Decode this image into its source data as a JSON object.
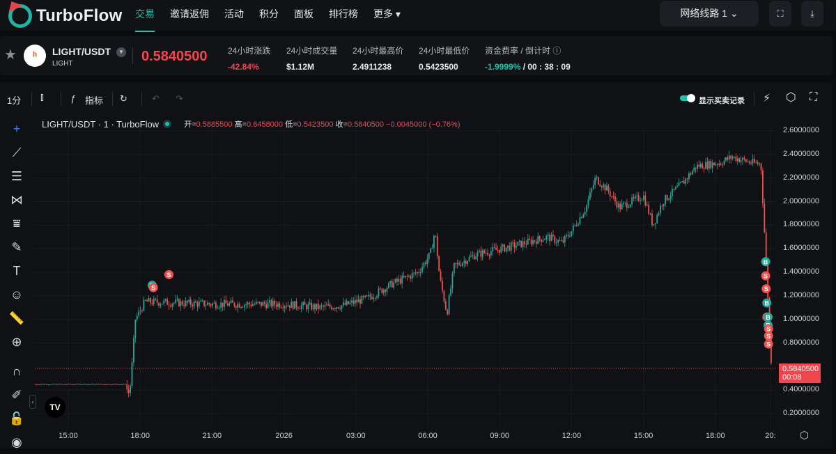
{
  "nav": {
    "brand": "TurboFlow",
    "items": [
      "交易",
      "邀请返佣",
      "活动",
      "积分",
      "面板",
      "排行榜",
      "更多 ▾"
    ],
    "network": "网络线路 1 ⌄"
  },
  "ticker": {
    "pair": "LIGHT/USDT",
    "base": "LIGHT",
    "coin_glyph": "LT",
    "last_price": "0.5840500",
    "stats": [
      {
        "label": "24小时涨跌",
        "value": "-42.84%"
      },
      {
        "label": "24小时成交量",
        "value": "$1.12M"
      },
      {
        "label": "24小时最高价",
        "value": "2.4911238"
      },
      {
        "label": "24小时最低价",
        "value": "0.5423500"
      }
    ],
    "funding_label": "资金费率 / 倒计时",
    "funding_rate": "-1.9999%",
    "countdown": "/ 00 : 38 : 09"
  },
  "toolbar": {
    "interval": "1分",
    "indicators": "指标",
    "show_trades": "显示买卖记录"
  },
  "legend": {
    "title": "LIGHT/USDT · 1 · TurboFlow",
    "open_l": "开=",
    "open": "0.5885500",
    "high_l": "高=",
    "high": "0.6458000",
    "low_l": "低=",
    "low": "0.5423500",
    "close_l": "收=",
    "close": "0.5840500",
    "change": "−0.0045000 (−0.76%)"
  },
  "price_tag": {
    "price": "0.5840500",
    "timer": "00:08"
  },
  "colors": {
    "up": "#26a69a",
    "down": "#ef5350",
    "accent": "#1fc2ad"
  },
  "chart_data": {
    "type": "candlestick",
    "ylim": [
      0.1,
      2.7
    ],
    "y_ticks": [
      "2.6000000",
      "2.4000000",
      "2.2000000",
      "2.0000000",
      "1.8000000",
      "1.6000000",
      "1.4000000",
      "1.2000000",
      "1.0000000",
      "0.8000000",
      "0.4000000",
      "0.2000000"
    ],
    "y_tick_values": [
      2.6,
      2.4,
      2.2,
      2.0,
      1.8,
      1.6,
      1.4,
      1.2,
      1.0,
      0.8,
      0.4,
      0.2
    ],
    "x_ticks": [
      "15:00",
      "18:00",
      "21:00",
      "2026",
      "03:00",
      "06:00",
      "09:00",
      "12:00",
      "15:00",
      "18:00",
      "20:"
    ],
    "x_tick_hours": [
      0,
      3,
      6,
      9,
      12,
      15,
      18,
      21,
      24,
      27,
      29.3
    ],
    "xlim_hours": [
      -1.4,
      29.6
    ],
    "path_hours_price": [
      [
        -1.4,
        0.45
      ],
      [
        2.4,
        0.45
      ],
      [
        2.5,
        0.36
      ],
      [
        2.6,
        0.45
      ],
      [
        2.8,
        1.0
      ],
      [
        3.2,
        1.15
      ],
      [
        6,
        1.13
      ],
      [
        9,
        1.13
      ],
      [
        10.5,
        1.1
      ],
      [
        11.5,
        1.12
      ],
      [
        12.5,
        1.18
      ],
      [
        13.5,
        1.3
      ],
      [
        14.6,
        1.4
      ],
      [
        15.1,
        1.55
      ],
      [
        15.3,
        1.75
      ],
      [
        15.5,
        1.35
      ],
      [
        15.8,
        1.05
      ],
      [
        16.1,
        1.45
      ],
      [
        17,
        1.55
      ],
      [
        18.5,
        1.62
      ],
      [
        20,
        1.7
      ],
      [
        20.6,
        1.65
      ],
      [
        21,
        1.75
      ],
      [
        21.6,
        1.95
      ],
      [
        22,
        2.2
      ],
      [
        22.5,
        2.1
      ],
      [
        23,
        1.95
      ],
      [
        24,
        2.05
      ],
      [
        24.4,
        1.8
      ],
      [
        24.8,
        2.0
      ],
      [
        25.6,
        2.15
      ],
      [
        26.2,
        2.3
      ],
      [
        27.2,
        2.33
      ],
      [
        27.7,
        2.38
      ],
      [
        28.5,
        2.33
      ],
      [
        28.9,
        2.32
      ],
      [
        29.1,
        1.55
      ],
      [
        29.35,
        0.58
      ]
    ],
    "trades": [
      [
        3.5,
        1.29,
        "B"
      ],
      [
        3.55,
        1.27,
        "S"
      ],
      [
        4.2,
        1.38,
        "S"
      ],
      [
        29.1,
        1.49,
        "B"
      ],
      [
        29.1,
        1.37,
        "S"
      ],
      [
        29.12,
        1.26,
        "S"
      ],
      [
        29.15,
        1.14,
        "B"
      ],
      [
        29.15,
        1.02,
        "S"
      ],
      [
        29.2,
        1.02,
        "B"
      ],
      [
        29.2,
        0.95,
        "B"
      ],
      [
        29.22,
        0.92,
        "S"
      ],
      [
        29.22,
        0.86,
        "S"
      ],
      [
        29.22,
        0.79,
        "S"
      ]
    ]
  }
}
